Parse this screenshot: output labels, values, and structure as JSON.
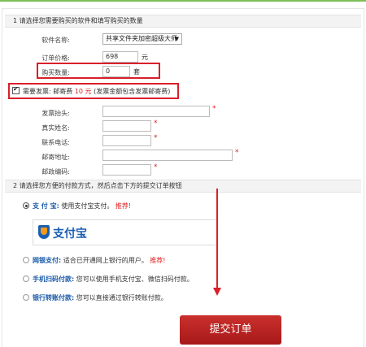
{
  "section1": {
    "title": "1 请选择您需要购买的软件和填写购买的数量"
  },
  "form": {
    "software_label": "软件名称:",
    "software_value": "共享文件夹加密超级大师",
    "price_label": "订单价格:",
    "price_value": "698",
    "price_unit": "元",
    "qty_label": "购买数量:",
    "qty_value": "0",
    "qty_unit": "套"
  },
  "invoice": {
    "checkbox_text": "需要发票: 邮寄费",
    "fee": "10 元",
    "note": "(发票金额包含发票邮寄费)"
  },
  "invoice_fields": [
    {
      "label": "发票抬头:"
    },
    {
      "label": "真实姓名:"
    },
    {
      "label": "联系电话:"
    },
    {
      "label": "邮寄地址:"
    },
    {
      "label": "邮政编码:"
    }
  ],
  "required_mark": "*",
  "section2": {
    "title": "2 请选择您方便的付款方式，然后点击下方的提交订单按钮"
  },
  "payments": {
    "alipay": {
      "name": "支 付 宝:",
      "desc": "使用支付宝支付。",
      "rec": "推荐!"
    },
    "alipay_logo": "支付宝",
    "netbank": {
      "name": "网银支付:",
      "desc": "适合已开通网上银行的用户。",
      "rec": "推荐!"
    },
    "scan": {
      "name": "手机扫码付款:",
      "desc": "您可以使用手机支付宝、微信扫码付款。"
    },
    "transfer": {
      "name": "银行转账付款:",
      "desc": "您可以直接通过银行转账付款。"
    }
  },
  "submit": {
    "label": "提交订单"
  },
  "colors": {
    "accent_red": "#d8202a",
    "brand_green": "#7bbf57",
    "link_blue": "#1a5aa8"
  }
}
